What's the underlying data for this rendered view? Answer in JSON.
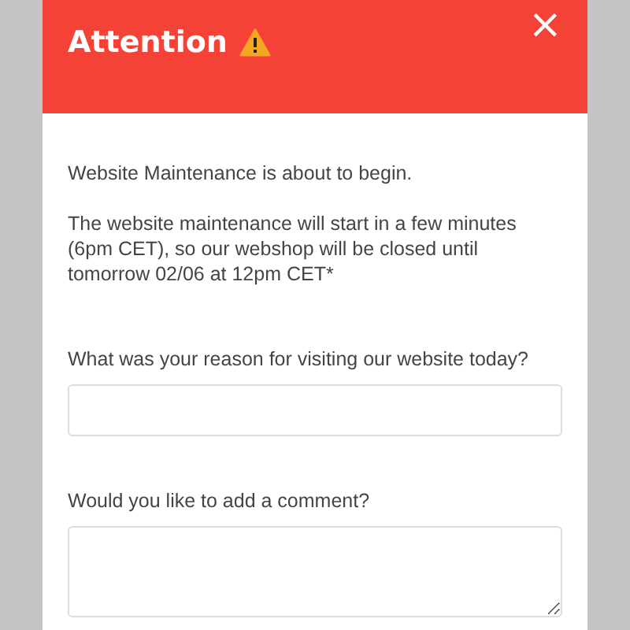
{
  "dialog": {
    "title": "Attention",
    "close": "×",
    "messages": [
      "Website Maintenance is about to begin.",
      "The website maintenance will start in a few minutes (6pm CET), so our webshop will be closed until tomorrow 02/06 at 12pm CET*"
    ],
    "fields": [
      {
        "kind": "input",
        "label": "What was your reason for visiting our website today?"
      },
      {
        "kind": "textarea",
        "label": "Would you like to add a comment?"
      }
    ]
  }
}
